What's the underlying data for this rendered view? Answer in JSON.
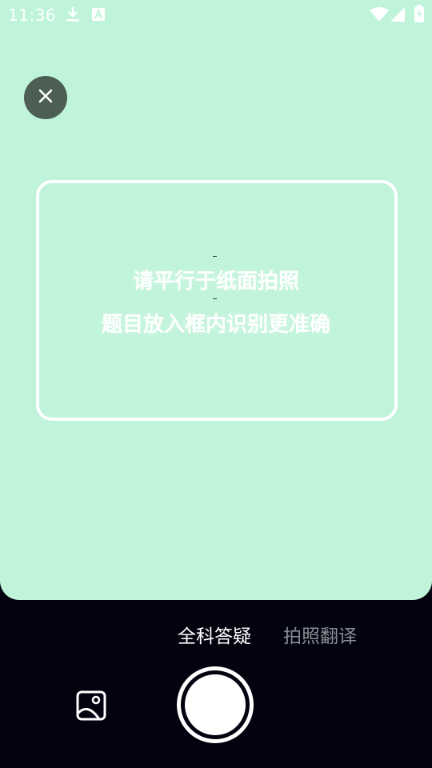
{
  "status_bar": {
    "time": "11:36",
    "icons": [
      "download-icon",
      "keyboard-a-icon",
      "wifi-icon",
      "signal-icon",
      "battery-charging-icon"
    ]
  },
  "viewfinder": {
    "background": "#c0f4da",
    "hint_line_1": "请平行于纸面拍照",
    "hint_line_2": "题目放入框内识别更准确"
  },
  "mode_tabs": [
    {
      "label": "全科答疑",
      "active": true
    },
    {
      "label": "拍照翻译",
      "active": false
    }
  ],
  "controls": {
    "gallery_icon": "gallery-icon",
    "shutter_icon": "shutter-icon",
    "close_icon": "close-icon"
  }
}
